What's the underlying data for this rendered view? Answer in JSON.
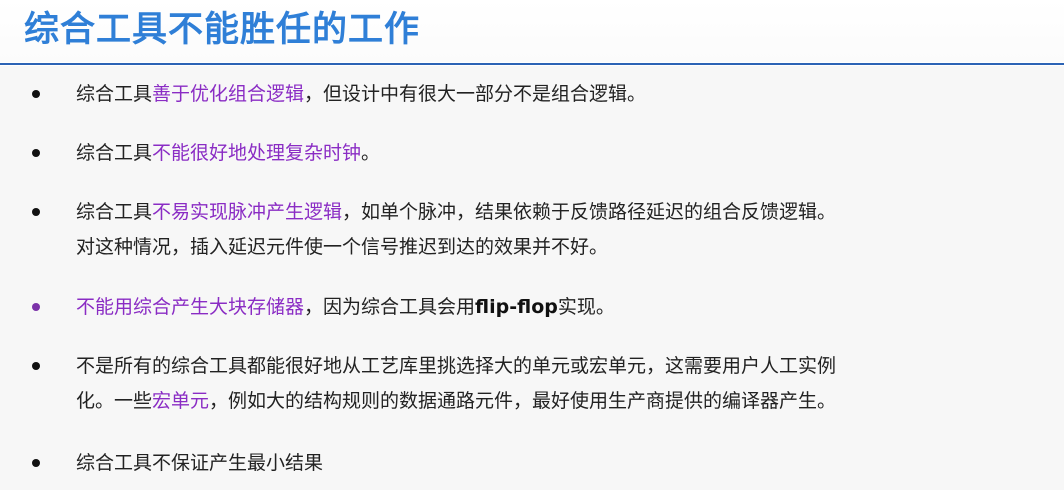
{
  "slide": {
    "title": "综合工具不能胜任的工作",
    "colors": {
      "title": "#2f7fd7",
      "divider": "#2c63b5",
      "highlight": "#8a2cc4",
      "body_text": "#222222",
      "background": "#f7f7f7"
    },
    "bullets": [
      {
        "prefix": "综合工具",
        "highlight": "善于优化组合逻辑",
        "suffix": "，但设计中有很大一部分不是组合逻辑。"
      },
      {
        "prefix": "综合工具",
        "highlight": "不能很好地处理复杂时钟",
        "suffix": "。"
      },
      {
        "prefix": "综合工具",
        "highlight": "不易实现脉冲产生逻辑",
        "suffix": "，如单个脉冲，结果依赖于反馈路径延迟的组合反馈逻辑。",
        "line2": "对这种情况，插入延迟元件使一个信号推迟到达的效果并不好。"
      },
      {
        "highlight": "不能用综合产生大块存储器",
        "middle": "，因为综合工具会用",
        "bold": "flip-flop",
        "suffix": "实现。"
      },
      {
        "line1": "不是所有的综合工具都能很好地从工艺库里挑选择大的单元或宏单元，这需要用户人工实例",
        "prefix": "化。一些",
        "highlight": "宏单元",
        "suffix": "，例如大的结构规则的数据通路元件，最好使用生产商提供的编译器产生。"
      },
      {
        "text": "综合工具不保证产生最小结果"
      }
    ]
  }
}
